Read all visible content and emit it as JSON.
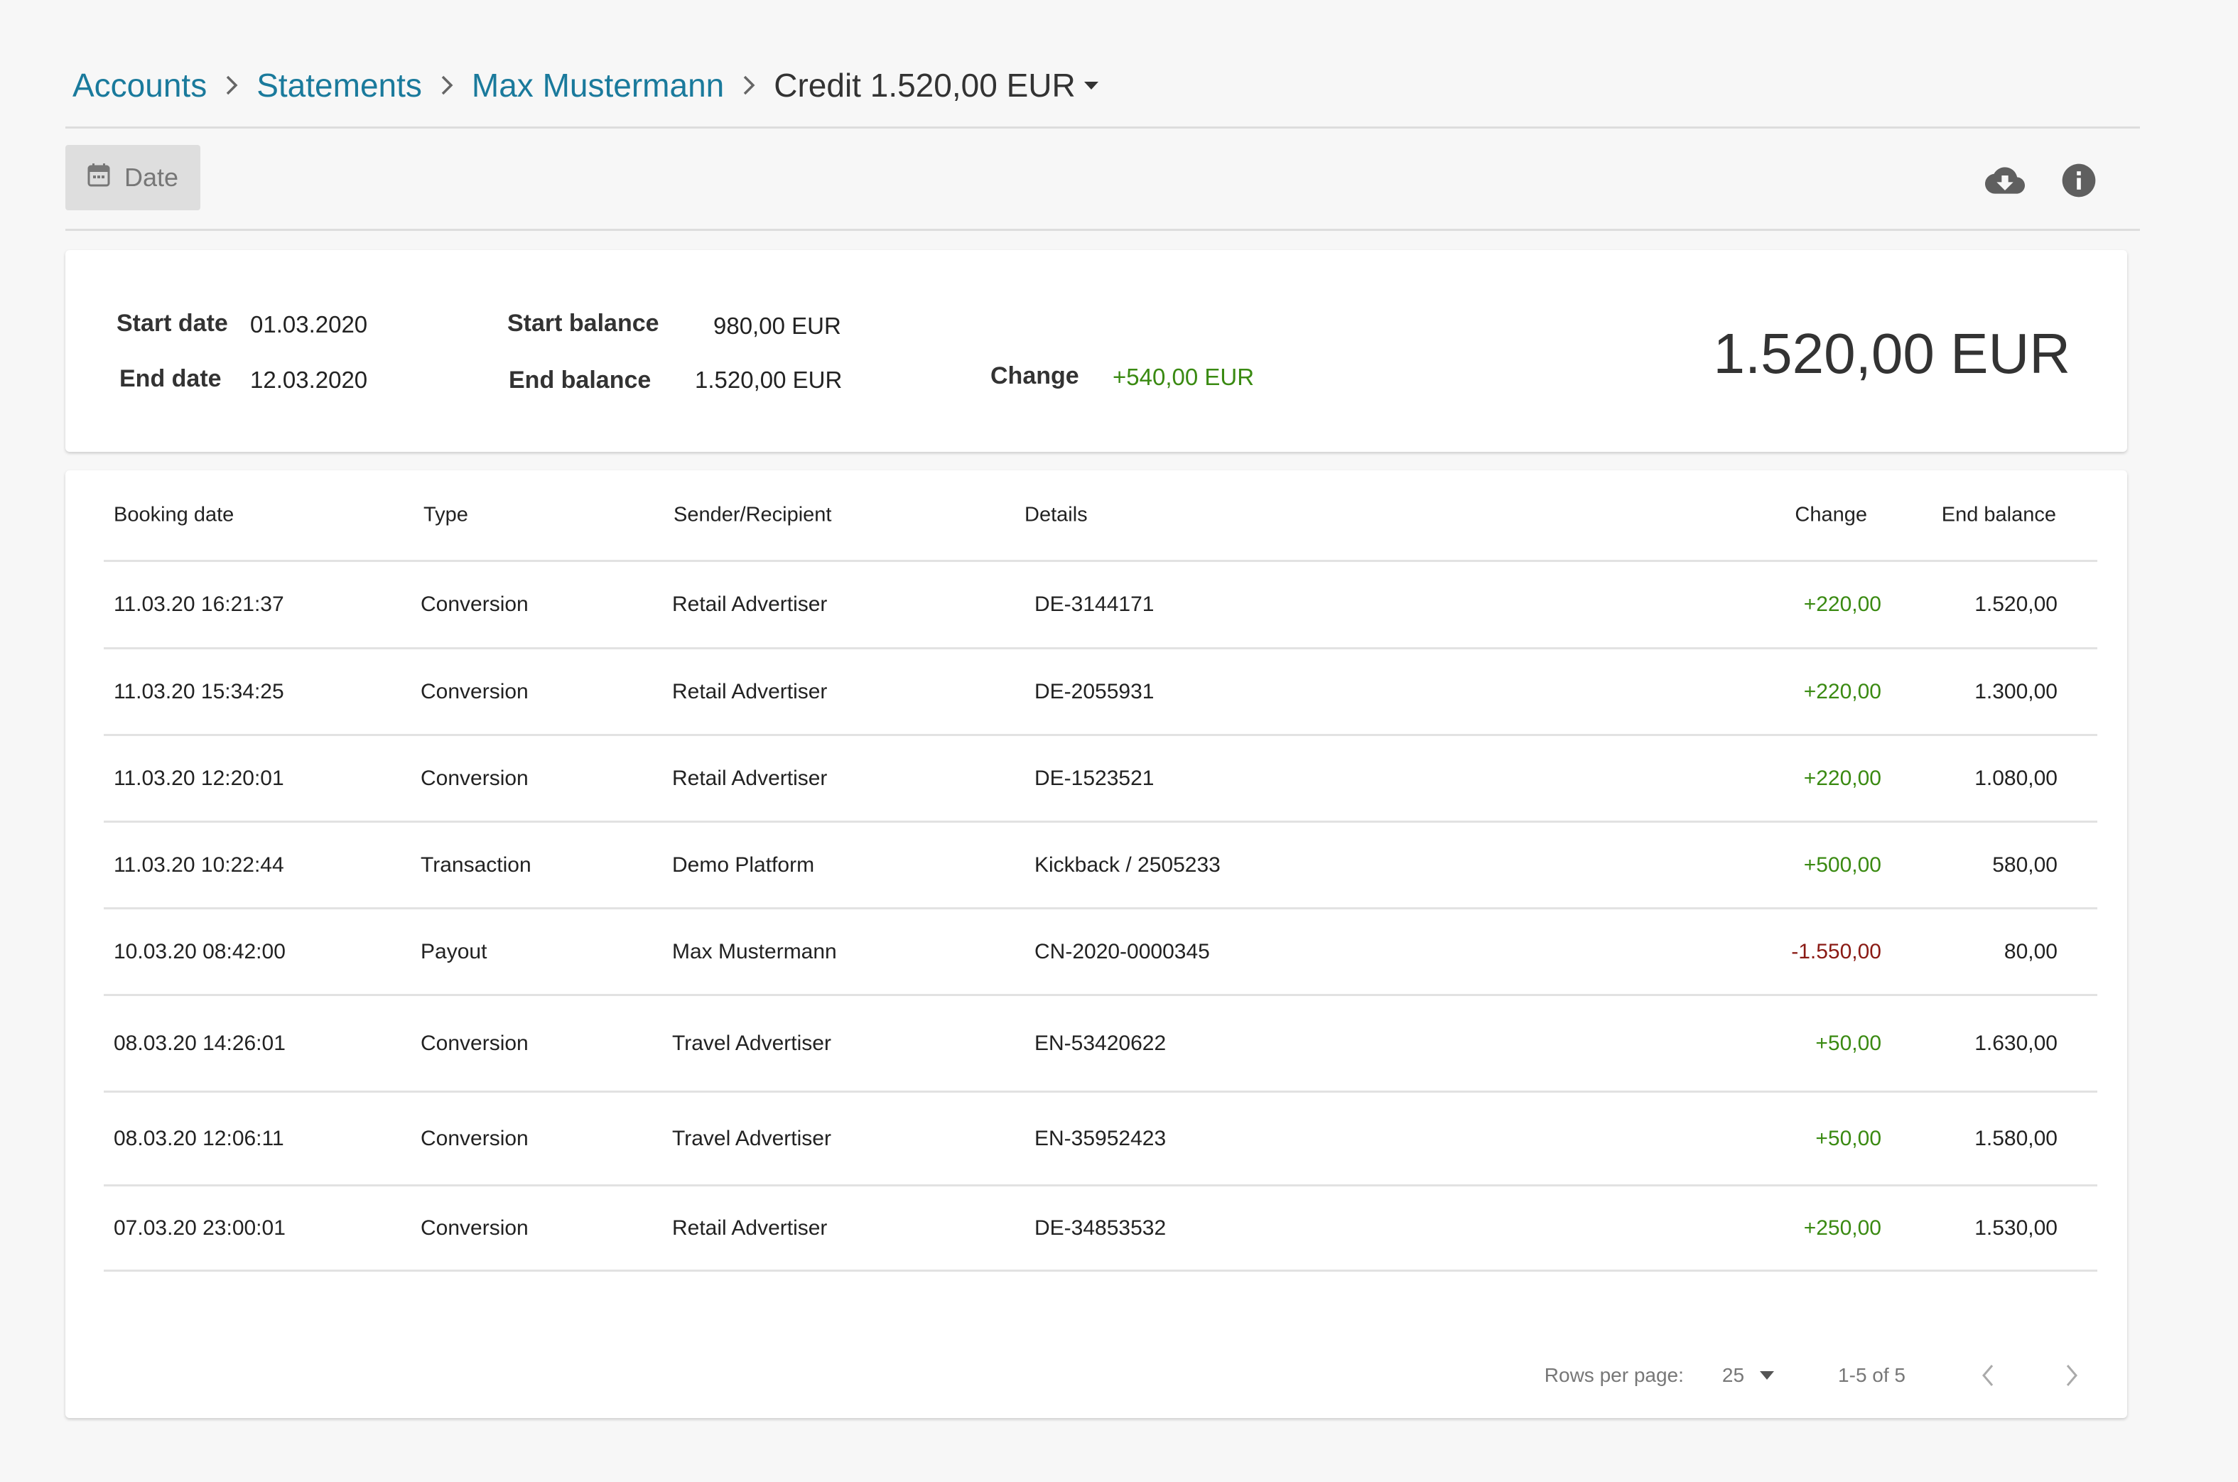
{
  "breadcrumb": {
    "items": [
      "Accounts",
      "Statements",
      "Max Mustermann"
    ],
    "current": "Credit 1.520,00 EUR"
  },
  "toolbar": {
    "date_label": "Date",
    "icons": [
      "calendar-icon",
      "cloud-download-icon",
      "info-icon"
    ]
  },
  "summary": {
    "start_date_label": "Start date",
    "start_date": "01.03.2020",
    "end_date_label": "End date",
    "end_date": "12.03.2020",
    "start_balance_label": "Start balance",
    "start_balance": "980,00 EUR",
    "end_balance_label": "End balance",
    "end_balance": "1.520,00 EUR",
    "change_label": "Change",
    "change": "+540,00 EUR",
    "total": "1.520,00 EUR"
  },
  "colors": {
    "link": "#1a7a9c",
    "positive": "#3a8a12",
    "negative": "#8a1a14"
  },
  "table": {
    "headers": {
      "booking_date": "Booking date",
      "type": "Type",
      "sender": "Sender/Recipient",
      "details": "Details",
      "change": "Change",
      "end_balance": "End balance"
    },
    "rows": [
      {
        "date": "11.03.20 16:21:37",
        "type": "Conversion",
        "sender": "Retail Advertiser",
        "details": "DE-3144171",
        "change": "+220,00",
        "balance": "1.520,00",
        "sign": "pos"
      },
      {
        "date": "11.03.20 15:34:25",
        "type": "Conversion",
        "sender": "Retail Advertiser",
        "details": "DE-2055931",
        "change": "+220,00",
        "balance": "1.300,00",
        "sign": "pos"
      },
      {
        "date": "11.03.20 12:20:01",
        "type": "Conversion",
        "sender": "Retail Advertiser",
        "details": "DE-1523521",
        "change": "+220,00",
        "balance": "1.080,00",
        "sign": "pos"
      },
      {
        "date": "11.03.20 10:22:44",
        "type": "Transaction",
        "sender": "Demo Platform",
        "details": "Kickback / 2505233",
        "change": "+500,00",
        "balance": "580,00",
        "sign": "pos"
      },
      {
        "date": "10.03.20 08:42:00",
        "type": "Payout",
        "sender": "Max Mustermann",
        "details": "CN-2020-0000345",
        "change": "-1.550,00",
        "balance": "80,00",
        "sign": "neg"
      },
      {
        "date": "08.03.20 14:26:01",
        "type": "Conversion",
        "sender": "Travel Advertiser",
        "details": "EN-53420622",
        "change": "+50,00",
        "balance": "1.630,00",
        "sign": "pos"
      },
      {
        "date": "08.03.20 12:06:11",
        "type": "Conversion",
        "sender": "Travel Advertiser",
        "details": "EN-35952423",
        "change": "+50,00",
        "balance": "1.580,00",
        "sign": "pos"
      },
      {
        "date": "07.03.20 23:00:01",
        "type": "Conversion",
        "sender": "Retail Advertiser",
        "details": "DE-34853532",
        "change": "+250,00",
        "balance": "1.530,00",
        "sign": "pos"
      }
    ]
  },
  "pagination": {
    "rows_per_page_label": "Rows per page:",
    "rows_per_page": "25",
    "range": "1-5 of 5"
  }
}
